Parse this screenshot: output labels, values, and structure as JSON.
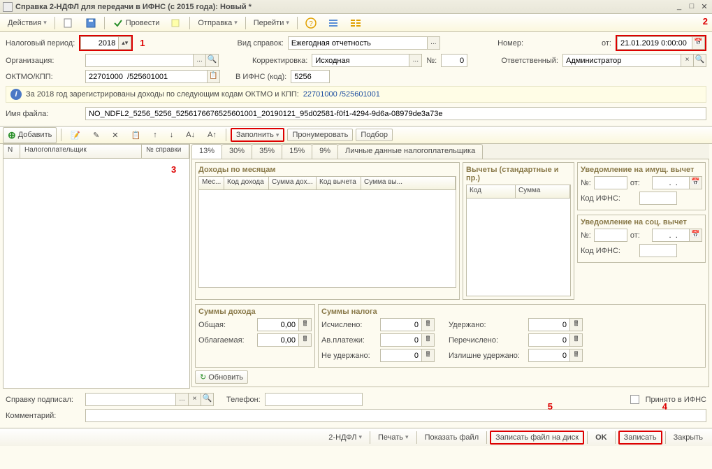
{
  "window": {
    "title": "Справка 2-НДФЛ для передачи в ИФНС (с 2015 года): Новый *"
  },
  "toolbar": {
    "actions": "Действия",
    "provesti": "Провести",
    "otpravka": "Отправка",
    "perejti": "Перейти"
  },
  "markers": {
    "m1": "1",
    "m2": "2",
    "m3": "3",
    "m4": "4",
    "m5": "5"
  },
  "header": {
    "tax_period_lbl": "Налоговый период:",
    "tax_period": "2018",
    "vid_spravok_lbl": "Вид справок:",
    "vid_spravok": "Ежегодная отчетность",
    "nomer_lbl": "Номер:",
    "ot_lbl": "от:",
    "date": "21.01.2019 0:00:00",
    "org_lbl": "Организация:",
    "org": "",
    "korrekt_lbl": "Корректировка:",
    "korrekt": "Исходная",
    "n2_lbl": "№:",
    "n2_val": "0",
    "otvet_lbl": "Ответственный:",
    "otvet": "Администратор",
    "oktmo_lbl": "ОКТМО/КПП:",
    "oktmo": "22701000  /525601001",
    "ifns_lbl": "В ИФНС (код):",
    "ifns": "5256",
    "info_text": "За 2018 год зарегистрированы доходы по следующим кодам ОКТМО и КПП:",
    "info_link": "22701000  /525601001",
    "file_lbl": "Имя файла:",
    "file": "NO_NDFL2_5256_5256_5256176676525601001_20190121_95d02581-f0f1-4294-9d6a-08979de3a73e"
  },
  "mid": {
    "add": "Добавить",
    "zapolnit": "Заполнить",
    "pronum": "Пронумеровать",
    "podbor": "Подбор"
  },
  "tabs": {
    "t13": "13%",
    "t30": "30%",
    "t35": "35%",
    "t15": "15%",
    "t9": "9%",
    "personal": "Личные данные налогоплательщика"
  },
  "left_cols": {
    "n": "N",
    "taxpayer": "Налогоплательщик",
    "spravka_n": "№ справки"
  },
  "panels": {
    "income_title": "Доходы по месяцам",
    "deduct_title": "Вычеты (стандартные и пр.)",
    "notice_prop_title": "Уведомление на имущ. вычет",
    "notice_soc_title": "Уведомление на соц. вычет",
    "n_lbl": "№:",
    "ot_lbl": "от:",
    "kod_ifns_lbl": "Код ИФНС:",
    "date_placeholder": "  .  .    "
  },
  "income_cols": {
    "mes": "Мес...",
    "kod_doh": "Код дохода",
    "sum_doh": "Сумма дох...",
    "kod_vych": "Код вычета",
    "sum_vych": "Сумма вы..."
  },
  "deduct_cols": {
    "kod": "Код",
    "summa": "Сумма"
  },
  "sums": {
    "income_title": "Суммы дохода",
    "tax_title": "Суммы налога",
    "obshaya_lbl": "Общая:",
    "obshaya": "0,00",
    "oblagaemaya_lbl": "Облагаемая:",
    "oblagaemaya": "0,00",
    "ischisleno_lbl": "Исчислено:",
    "ischisleno": "0",
    "av_lbl": "Ав.платежи:",
    "av": "0",
    "ne_ud_lbl": "Не удержано:",
    "ne_ud": "0",
    "uderzhano_lbl": "Удержано:",
    "uderzhano": "0",
    "perechisleno_lbl": "Перечислено:",
    "perechisleno": "0",
    "izlishne_lbl": "Излишне удержано:",
    "izlishne": "0",
    "obnovit": "Обновить"
  },
  "footer": {
    "podpisal_lbl": "Справку подписал:",
    "telefon_lbl": "Телефон:",
    "prinyato": "Принято в ИФНС",
    "kommentarij_lbl": "Комментарий:"
  },
  "bottom": {
    "ndfl": "2-НДФЛ",
    "pechat": "Печать",
    "pokazat": "Показать файл",
    "zapisat_disk": "Записать файл на диск",
    "ok": "OK",
    "zapisat": "Записать",
    "zakryt": "Закрыть"
  }
}
